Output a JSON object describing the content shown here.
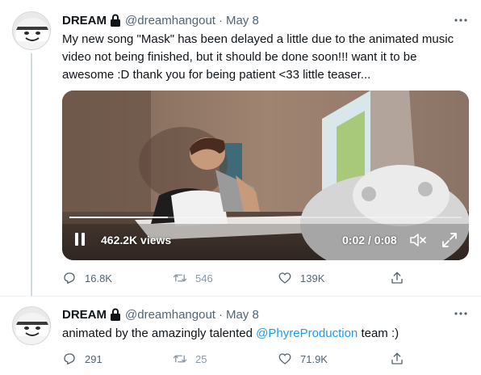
{
  "tweets": [
    {
      "name": "DREAM",
      "handle": "@dreamhangout",
      "separator": "·",
      "date": "May 8",
      "text": "My new song \"Mask\" has been delayed a little due to the animated music video not being finished, but it should be done soon!!! want it to be awesome :D thank you for being patient <33 little teaser...",
      "video": {
        "views": "462.2K views",
        "time": "0:02 / 0:08",
        "progress": 0.25
      },
      "actions": {
        "replies": "16.8K",
        "retweets": "546",
        "likes": "139K"
      }
    },
    {
      "name": "DREAM",
      "handle": "@dreamhangout",
      "separator": "·",
      "date": "May 8",
      "text_before": "animated by the amazingly talented ",
      "mention": "@PhyreProduction",
      "text_after": " team :)",
      "actions": {
        "replies": "291",
        "retweets": "25",
        "likes": "71.9K"
      }
    }
  ],
  "colors": {
    "link": "#1d9bf0",
    "secondary_text": "#536471",
    "thread_line": "#cfd9de"
  },
  "icons": [
    "more-icon",
    "lock-icon",
    "pause-icon",
    "mute-icon",
    "expand-icon",
    "reply-icon",
    "retweet-icon",
    "like-icon",
    "share-icon"
  ]
}
